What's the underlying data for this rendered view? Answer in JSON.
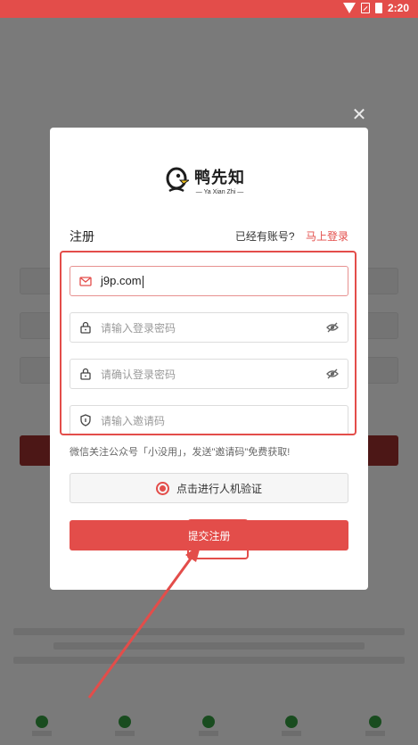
{
  "status_bar": {
    "time": "2:20"
  },
  "modal": {
    "close_icon": "close-icon",
    "logo": {
      "name": "鸭先知",
      "subtitle": "— Ya Xian Zhi —"
    },
    "title": "注册",
    "login_hint": "已经有账号?",
    "login_link": "马上登录",
    "fields": {
      "email": {
        "value": "j9p.com",
        "icon": "mail-icon"
      },
      "password": {
        "placeholder": "请输入登录密码",
        "icon": "lock-icon"
      },
      "confirm_password": {
        "placeholder": "请确认登录密码",
        "icon": "lock-icon"
      },
      "invite_code": {
        "placeholder": "请输入邀请码",
        "icon": "shield-icon"
      }
    },
    "hint": "微信关注公众号「小没用」，发送\"邀请码\"免费获取!",
    "verify_label": "点击进行人机验证",
    "submit_label": "提交注册"
  },
  "colors": {
    "accent": "#e34d4a",
    "overlay": "rgba(0,0,0,0.45)"
  }
}
